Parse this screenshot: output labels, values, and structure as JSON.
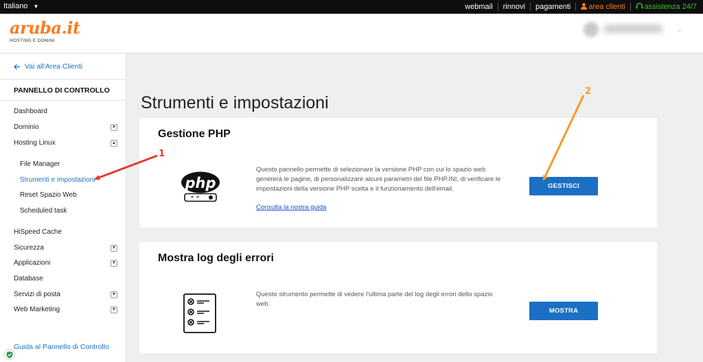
{
  "topbar": {
    "language": "Italiano",
    "links": {
      "webmail": "webmail",
      "rinnovi": "rinnovi",
      "pagamenti": "pagamenti",
      "area_clienti": "area clienti",
      "assistenza": "assistenza 24/7"
    }
  },
  "header": {
    "logo_text": "aruba.it",
    "logo_tagline": "HOSTING E DOMINI"
  },
  "sidebar": {
    "back_link": "Vai all'Area Clienti",
    "panel_title": "PANNELLO DI CONTROLLO",
    "items": {
      "dashboard": "Dashboard",
      "dominio": "Dominio",
      "hosting_linux": "Hosting Linux",
      "file_manager": "File Manager",
      "strumenti": "Strumenti e impostazioni",
      "reset": "Reset Spazio Web",
      "scheduled": "Scheduled task",
      "hispeed": "HiSpeed Cache",
      "sicurezza": "Sicurezza",
      "applicazioni": "Applicazioni",
      "database": "Database",
      "servizi_posta": "Servizi di posta",
      "web_marketing": "Web Marketing"
    },
    "guide_link": "Guida al Pannello di Controllo"
  },
  "main": {
    "title": "Strumenti e impostazioni",
    "php_card": {
      "title": "Gestione PHP",
      "description": "Questo pannello permette di selezionare la versione PHP con cui lo spazio web genererà le pagine, di personalizzare alcuni parametri del file PHP.INI, di verificare le impostazioni della versione PHP scelta e il funzionamento dell'email.",
      "guide_link": "Consulta la nostra guida",
      "button": "GESTISCI",
      "icon_text": "php"
    },
    "log_card": {
      "title": "Mostra log degli errori",
      "description": "Questo strumento permette di vedere l'ultima parte del log degli errori dello spazio web.",
      "button": "MOSTRA"
    }
  },
  "annotations": {
    "marker_1": "1",
    "marker_2": "2"
  },
  "colors": {
    "brand_orange": "#f57e20",
    "link_blue": "#1a73c8",
    "button_blue": "#1b6fc4",
    "arrow_red": "#e23b30",
    "arrow_orange": "#f79a25"
  }
}
